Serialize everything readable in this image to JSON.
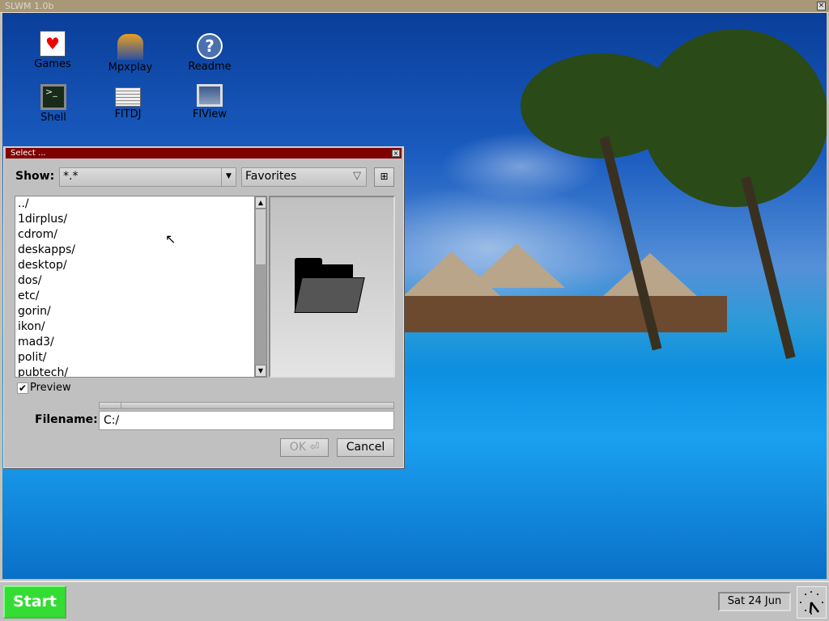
{
  "wm": {
    "title": "SLWM 1.0b",
    "close": "×"
  },
  "desktop": {
    "icons": [
      {
        "label": "Games",
        "icon": "cards-icon"
      },
      {
        "label": "Mpxplay",
        "icon": "jukebox-icon"
      },
      {
        "label": "Readme",
        "icon": "help-icon"
      },
      {
        "label": "Shell",
        "icon": "terminal-icon"
      },
      {
        "label": "FlTDJ",
        "icon": "newspaper-icon"
      },
      {
        "label": "FlView",
        "icon": "image-viewer-icon"
      }
    ]
  },
  "dialog": {
    "title": "Select ...",
    "close": "×",
    "show_label": "Show:",
    "filter": "*.*",
    "favorites": "Favorites",
    "files": [
      "../",
      "1dirplus/",
      "cdrom/",
      "deskapps/",
      "desktop/",
      "dos/",
      "etc/",
      "gorin/",
      "ikon/",
      "mad3/",
      "polit/",
      "pubtech/"
    ],
    "preview_label": "Preview",
    "preview_checked": true,
    "filename_label": "Filename:",
    "filename": "C:/",
    "ok": "OK ⏎",
    "cancel": "Cancel"
  },
  "taskbar": {
    "start": "Start",
    "date": "Sat 24 Jun",
    "start_color": "#33dd33"
  }
}
